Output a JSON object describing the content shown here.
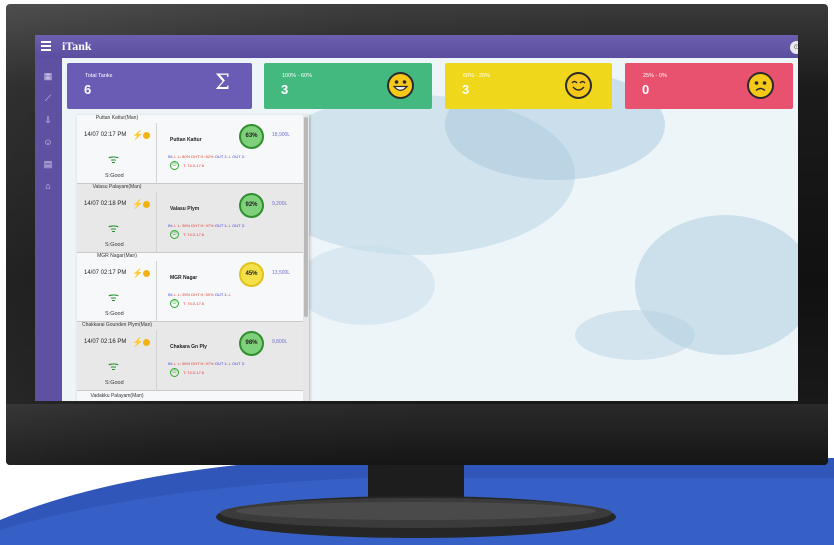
{
  "colors": {
    "topbar": "#5b4d9f",
    "sidebar": "#5e51a2",
    "total_card": "#6a5cb5",
    "high_card": "#43b97f",
    "mid_card": "#efd81b",
    "low_card": "#e8526f",
    "stand_blue": "#2f56b8"
  },
  "app": {
    "title": "iTank",
    "user_button": "⊙"
  },
  "sidebar": {
    "icons": [
      "grid-icon",
      "chart-line-icon",
      "download-icon",
      "user-icon",
      "table-icon",
      "lock-icon"
    ]
  },
  "cards": [
    {
      "label": "Total Tanks",
      "value": "6",
      "icon": "sigma-icon",
      "glyph": "Σ"
    },
    {
      "label": "100% - 60%",
      "value": "3",
      "icon": "happy-face-icon"
    },
    {
      "label": "60% - 25%",
      "value": "3",
      "icon": "smile-face-icon"
    },
    {
      "label": "25% - 0%",
      "value": "0",
      "icon": "sad-face-icon"
    }
  ],
  "tanks": [
    {
      "location": "Puttan Kattur(Man)",
      "time": "14/07 02:17 PM",
      "bolt": "⚡",
      "wifi": "ᯤ",
      "signal": "S:Good",
      "name": "Puttan Kattur",
      "level": "63%",
      "level_value": 63,
      "volume": "18,900L",
      "in": "IN:",
      "stats": "L: 80%  DHT  H: 82%",
      "out1": "OUT 1:",
      "out2": "OUT 2:",
      "temp": "T: 74.0-17.6"
    },
    {
      "location": "Valasu Palayam(Man)",
      "time": "14/07 02:18 PM",
      "bolt": "⚡",
      "wifi": "ᯤ",
      "signal": "S:Good",
      "name": "Valasu Plym",
      "level": "92%",
      "level_value": 92,
      "volume": "9,200L",
      "in": "IN:",
      "stats": "L: 96%  DHT  H: 97%",
      "out1": "OUT 1:",
      "out2": "OUT 2:",
      "temp": "T: 74.0-17.6"
    },
    {
      "location": "MGR Nagar(Man)",
      "time": "14/07 02:17 PM",
      "bolt": "⚡",
      "wifi": "ᯤ",
      "signal": "S:Good",
      "name": "MGR Nagar",
      "level": "45%",
      "level_value": 45,
      "volume": "13,500L",
      "in": "IN:",
      "stats": "L: 25%  DHT  H: 50%",
      "out1": "OUT 1:",
      "out2": "",
      "temp": "T: 74.0-17.6"
    },
    {
      "location": "Chakkarai Gounden Plym(Man)",
      "time": "14/07 02:16 PM",
      "bolt": "⚡",
      "wifi": "ᯤ",
      "signal": "S:Good",
      "name": "Chakara Gn Ply",
      "level": "98%",
      "level_value": 98,
      "volume": "9,800L",
      "in": "IN:",
      "stats": "L: 96%  DHT  H: 97%",
      "out1": "OUT 1:",
      "out2": "OUT 2:",
      "temp": "T: 74.0-17.6"
    }
  ],
  "last_location": "Vadakku Palayam(Man)"
}
